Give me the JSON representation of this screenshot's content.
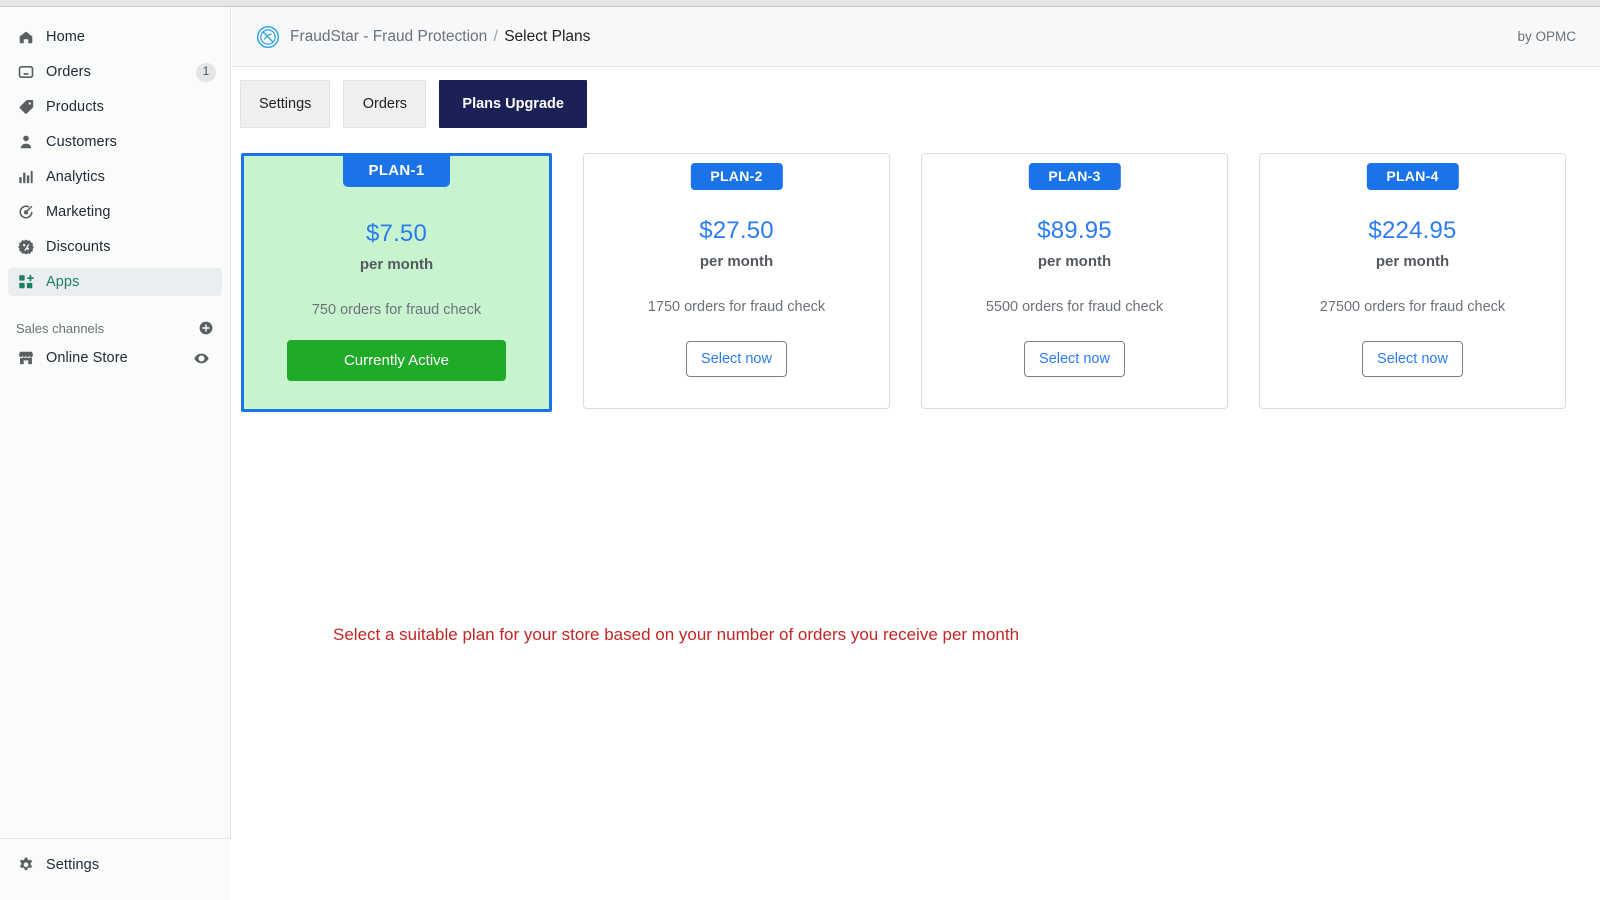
{
  "sidebar": {
    "items": [
      {
        "label": "Home",
        "icon": "home-icon",
        "badge": "",
        "active": false
      },
      {
        "label": "Orders",
        "icon": "orders-inbox-icon",
        "badge": "1",
        "active": false
      },
      {
        "label": "Products",
        "icon": "products-tag-icon",
        "badge": "",
        "active": false
      },
      {
        "label": "Customers",
        "icon": "customers-person-icon",
        "badge": "",
        "active": false
      },
      {
        "label": "Analytics",
        "icon": "analytics-bars-icon",
        "badge": "",
        "active": false
      },
      {
        "label": "Marketing",
        "icon": "marketing-megaphone-icon",
        "badge": "",
        "active": false
      },
      {
        "label": "Discounts",
        "icon": "discounts-percent-icon",
        "badge": "",
        "active": false
      },
      {
        "label": "Apps",
        "icon": "apps-grid-icon",
        "badge": "",
        "active": true
      }
    ],
    "sales_channels": {
      "title": "Sales channels",
      "add_icon": "plus-circle-icon",
      "store": {
        "label": "Online Store",
        "icon": "storefront-icon",
        "action_icon": "eye-icon"
      }
    },
    "footer": {
      "label": "Settings",
      "icon": "gear-icon"
    },
    "active_color": "#1a7f64"
  },
  "topbar": {
    "app_icon": "fraudstar-logo-icon",
    "app_name": "FraudStar - Fraud Protection",
    "separator": "/",
    "page": "Select Plans",
    "byline": "by OPMC"
  },
  "tabs": [
    {
      "label": "Settings",
      "selected": false
    },
    {
      "label": "Orders",
      "selected": false
    },
    {
      "label": "Plans Upgrade",
      "selected": true
    }
  ],
  "tab_selected_color": "#1b2156",
  "plans": [
    {
      "badge": "PLAN-1",
      "price": "$7.50",
      "period": "per month",
      "orders": "750 orders for fraud check",
      "action_label": "Currently Active",
      "current": true
    },
    {
      "badge": "PLAN-2",
      "price": "$27.50",
      "period": "per month",
      "orders": "1750 orders for fraud check",
      "action_label": "Select now",
      "current": false
    },
    {
      "badge": "PLAN-3",
      "price": "$89.95",
      "period": "per month",
      "orders": "5500 orders for fraud check",
      "action_label": "Select now",
      "current": false
    },
    {
      "badge": "PLAN-4",
      "price": "$224.95",
      "period": "per month",
      "orders": "27500 orders for fraud check",
      "action_label": "Select now",
      "current": false
    }
  ],
  "colors": {
    "badge_blue": "#1a73e8",
    "price_blue": "#2b7cf0",
    "active_green": "#1faa27",
    "current_card_bg": "#c7f3ce",
    "hint_red": "#c22626"
  },
  "hint": "Select a suitable plan for your store based on your number of orders you receive per month"
}
